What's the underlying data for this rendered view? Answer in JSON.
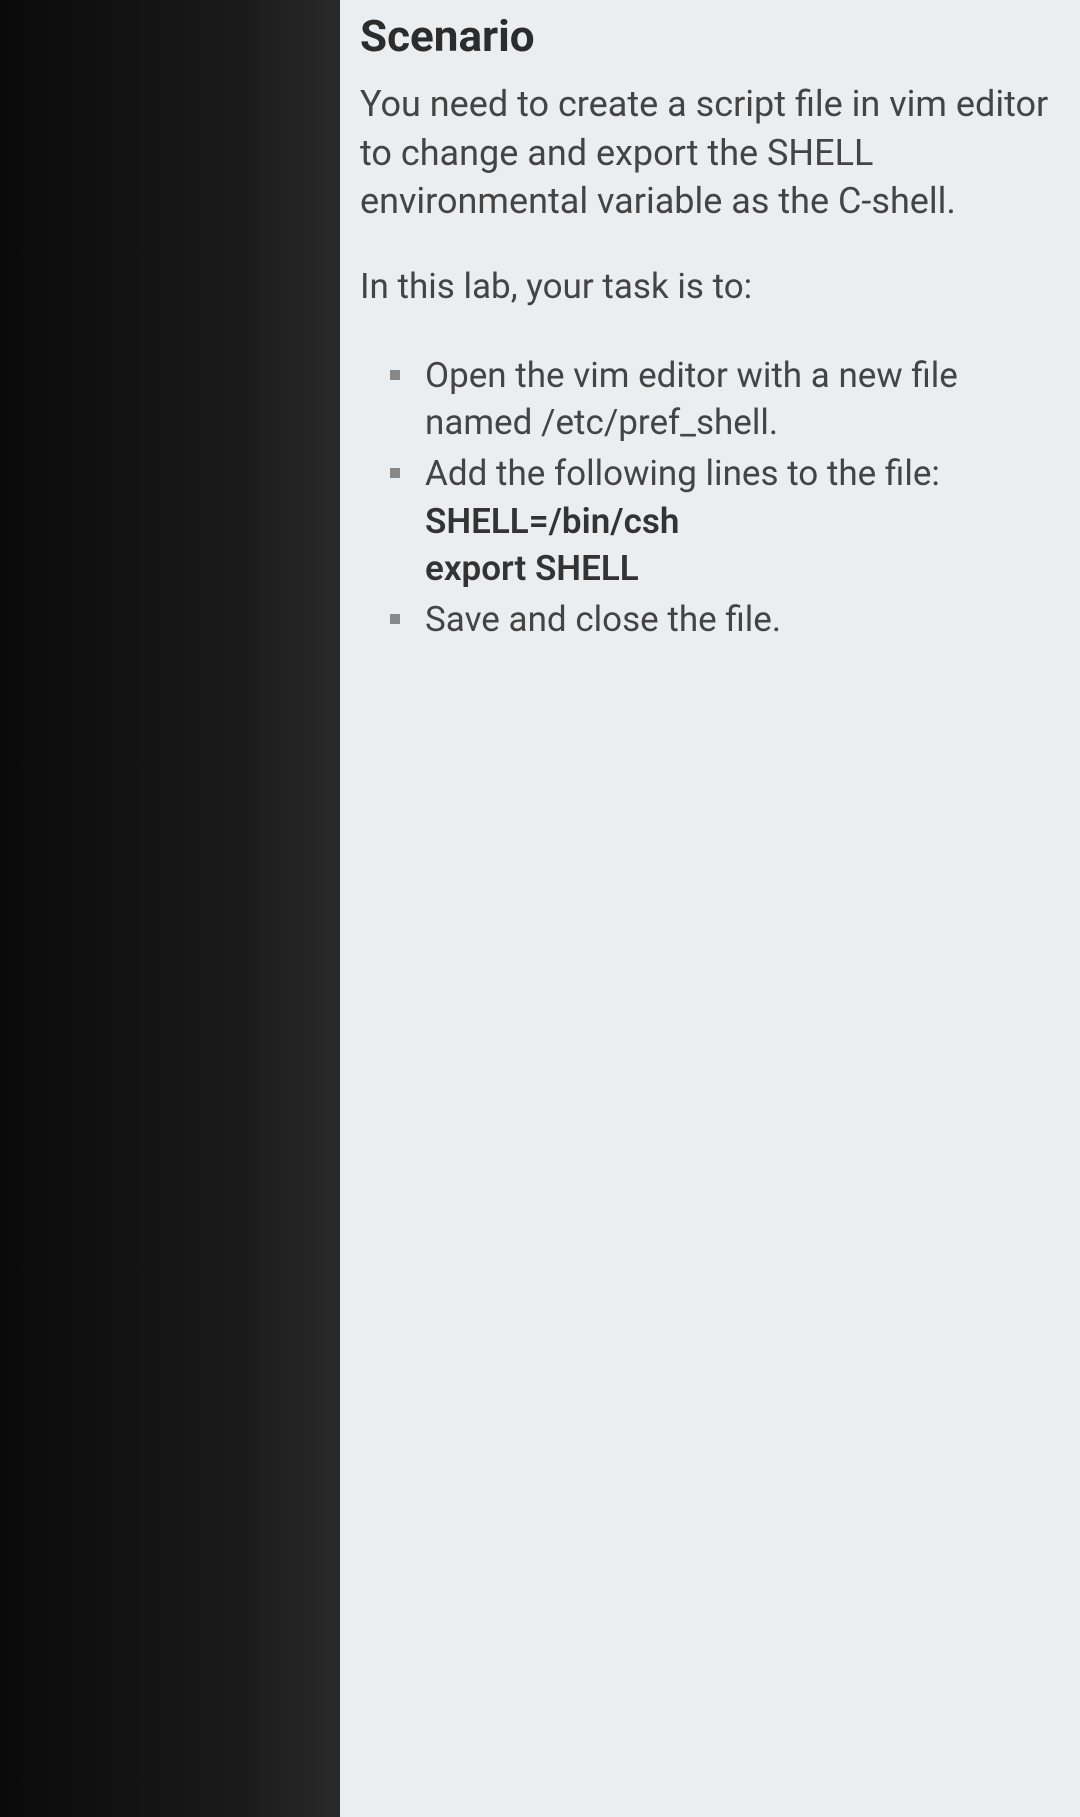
{
  "heading": "Scenario",
  "intro": "You need to create a script file in vim editor to change and export the SHELL environmental variable as the C-shell.",
  "task_prompt": "In this lab, your task is to:",
  "tasks": {
    "item1": {
      "text_a": "Open the vim editor with a new file named ",
      "text_b": "/etc/pref_shell."
    },
    "item2": {
      "text": "Add the following lines to the file:",
      "code1": "SHELL=/bin/csh",
      "code2": "export SHELL"
    },
    "item3": {
      "text": "Save and close the file."
    }
  }
}
